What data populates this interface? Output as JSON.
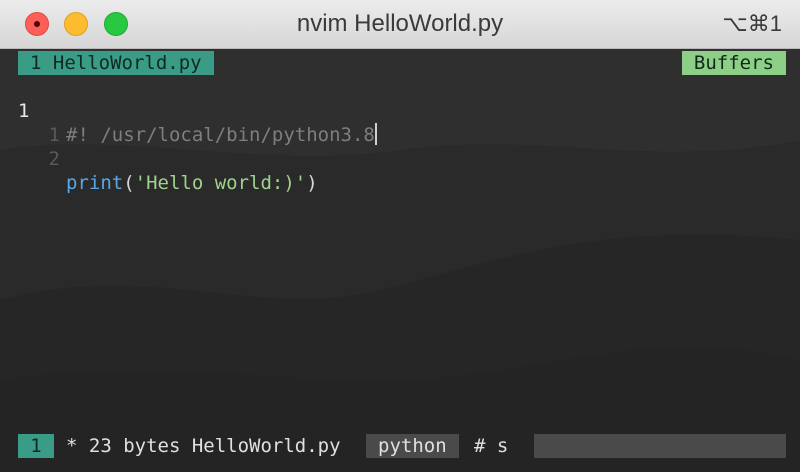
{
  "window": {
    "title": "nvim HelloWorld.py",
    "shortcut": "⌥⌘1"
  },
  "tabline": {
    "active_tab": "1 HelloWorld.py",
    "buffers_label": "Buffers"
  },
  "editor": {
    "lines": [
      {
        "number": "1",
        "relative": "",
        "text": "#! /usr/local/bin/python3.8"
      },
      {
        "number": "",
        "relative": "1",
        "text": ""
      },
      {
        "number": "",
        "relative": "2",
        "fn": "print",
        "open": "(",
        "string": "'Hello world:)'",
        "close": ")"
      }
    ]
  },
  "statusline": {
    "mode_number": "1",
    "file_info": "* 23 bytes HelloWorld.py",
    "filetype": "python",
    "symbol": "# s"
  },
  "colors": {
    "accent_teal": "#3a9b86",
    "accent_green": "#8dcf86",
    "string_green": "#9fd38a",
    "function_blue": "#5aa7e8",
    "close_red": "#fc5f57",
    "minimize_yellow": "#fdbc2e",
    "zoom_green": "#28c840"
  }
}
